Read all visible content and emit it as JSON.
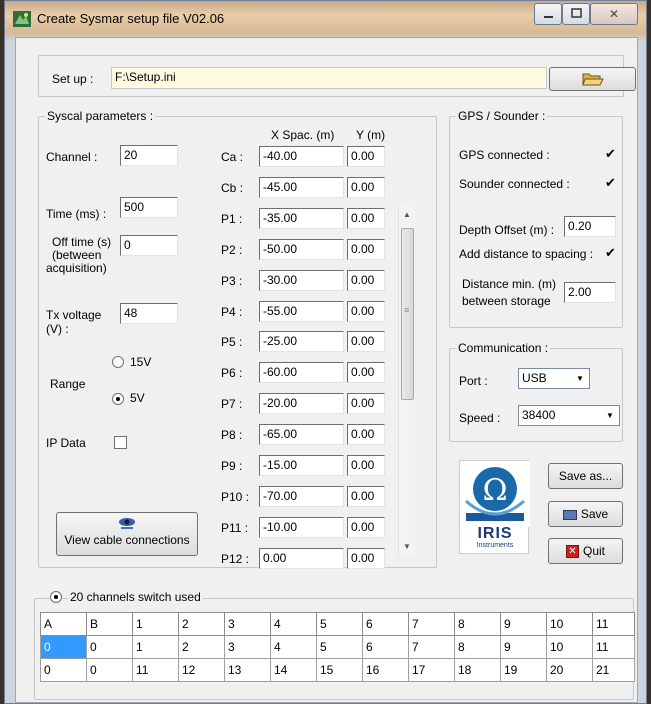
{
  "window": {
    "title": "Create Sysmar setup file  V02.06",
    "close_glyph": "✕"
  },
  "setup": {
    "label": "Set up :",
    "path": "F:\\Setup.ini",
    "browse_icon": "open-folder-icon"
  },
  "syscal": {
    "group_label": "Syscal parameters :",
    "channel_label": "Channel :",
    "channel_value": "20",
    "time_label": "Time (ms) :",
    "time_value": "500",
    "offtime_label_1": "Off time  (s)",
    "offtime_label_2": "(between",
    "offtime_label_3": "acquisition)",
    "offtime_value": "0",
    "txvoltage_label_1": "Tx voltage",
    "txvoltage_label_2": "(V) :",
    "txvoltage_value": "48",
    "range_label": "Range",
    "range_15v": "15V",
    "range_5v": "5V",
    "ipdata_label": "IP Data",
    "view_cable_label": "View cable connections",
    "xspac_header": "X Spac. (m)",
    "y_header": "Y (m)",
    "electrodes": [
      {
        "name": "Ca :",
        "x": "-40.00",
        "y": "0.00"
      },
      {
        "name": "Cb :",
        "x": "-45.00",
        "y": "0.00"
      },
      {
        "name": "P1 :",
        "x": "-35.00",
        "y": "0.00"
      },
      {
        "name": "P2 :",
        "x": "-50.00",
        "y": "0.00"
      },
      {
        "name": "P3 :",
        "x": "-30.00",
        "y": "0.00"
      },
      {
        "name": "P4 :",
        "x": "-55.00",
        "y": "0.00"
      },
      {
        "name": "P5 :",
        "x": "-25.00",
        "y": "0.00"
      },
      {
        "name": "P6 :",
        "x": "-60.00",
        "y": "0.00"
      },
      {
        "name": "P7 :",
        "x": "-20.00",
        "y": "0.00"
      },
      {
        "name": "P8 :",
        "x": "-65.00",
        "y": "0.00"
      },
      {
        "name": "P9 :",
        "x": "-15.00",
        "y": "0.00"
      },
      {
        "name": "P10 :",
        "x": "-70.00",
        "y": "0.00"
      },
      {
        "name": "P11 :",
        "x": "-10.00",
        "y": "0.00"
      },
      {
        "name": "P12 :",
        "x": "0.00",
        "y": "0.00"
      }
    ]
  },
  "gps": {
    "group_label": "GPS / Sounder :",
    "gps_connected": "GPS connected :",
    "sounder_connected": "Sounder connected :",
    "depth_offset_label": "Depth Offset (m) :",
    "depth_offset_value": "0.20",
    "add_distance_label": "Add distance to spacing :",
    "distance_min_label_1": "Distance min. (m)",
    "distance_min_label_2": "between storage",
    "distance_min_value": "2.00"
  },
  "communication": {
    "group_label": "Communication :",
    "port_label": "Port :",
    "port_value": "USB",
    "speed_label": "Speed :",
    "speed_value": "38400"
  },
  "logo": {
    "text": "IRIS",
    "subtext": "Instruments"
  },
  "buttons": {
    "save_as": "Save as...",
    "save": "Save",
    "quit": "Quit"
  },
  "switch": {
    "label": "20 channels switch used",
    "headers": [
      "A",
      "B",
      "1",
      "2",
      "3",
      "4",
      "5",
      "6",
      "7",
      "8",
      "9",
      "10",
      "11"
    ],
    "row1": [
      "0",
      "0",
      "1",
      "2",
      "3",
      "4",
      "5",
      "6",
      "7",
      "8",
      "9",
      "10",
      "11"
    ],
    "row2": [
      "0",
      "0",
      "11",
      "12",
      "13",
      "14",
      "15",
      "16",
      "17",
      "18",
      "19",
      "20",
      "21"
    ]
  },
  "colors": {
    "selection": "#3399ff",
    "setup_field_bg": "#fffbe0",
    "quit_red": "#cc2222"
  }
}
